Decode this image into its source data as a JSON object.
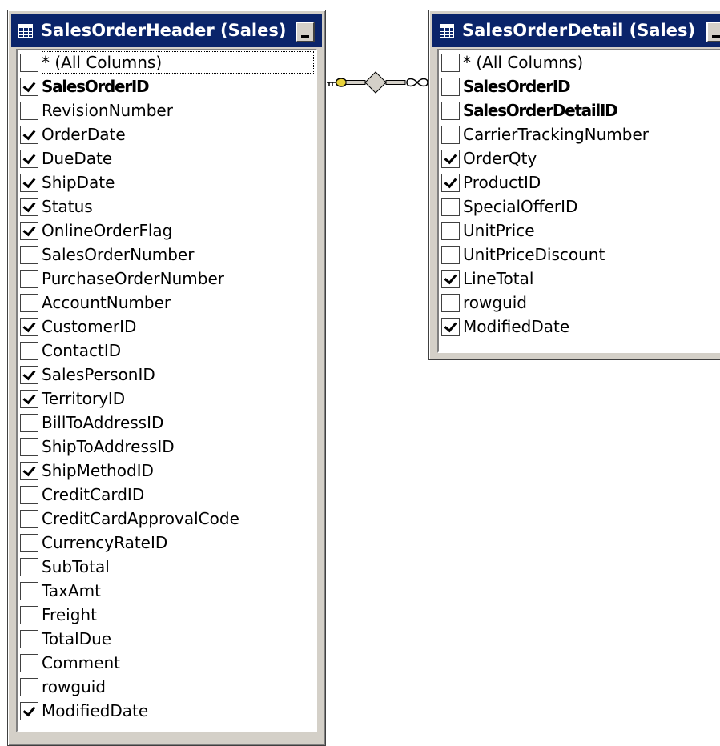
{
  "tables": [
    {
      "title": "SalesOrderHeader (Sales)",
      "columns": [
        {
          "label": "* (All Columns)",
          "checked": false,
          "key": false
        },
        {
          "label": "SalesOrderID",
          "checked": true,
          "key": true
        },
        {
          "label": "RevisionNumber",
          "checked": false,
          "key": false
        },
        {
          "label": "OrderDate",
          "checked": true,
          "key": false
        },
        {
          "label": "DueDate",
          "checked": true,
          "key": false
        },
        {
          "label": "ShipDate",
          "checked": true,
          "key": false
        },
        {
          "label": "Status",
          "checked": true,
          "key": false
        },
        {
          "label": "OnlineOrderFlag",
          "checked": true,
          "key": false
        },
        {
          "label": "SalesOrderNumber",
          "checked": false,
          "key": false
        },
        {
          "label": "PurchaseOrderNumber",
          "checked": false,
          "key": false
        },
        {
          "label": "AccountNumber",
          "checked": false,
          "key": false
        },
        {
          "label": "CustomerID",
          "checked": true,
          "key": false
        },
        {
          "label": "ContactID",
          "checked": false,
          "key": false
        },
        {
          "label": "SalesPersonID",
          "checked": true,
          "key": false
        },
        {
          "label": "TerritoryID",
          "checked": true,
          "key": false
        },
        {
          "label": "BillToAddressID",
          "checked": false,
          "key": false
        },
        {
          "label": "ShipToAddressID",
          "checked": false,
          "key": false
        },
        {
          "label": "ShipMethodID",
          "checked": true,
          "key": false
        },
        {
          "label": "CreditCardID",
          "checked": false,
          "key": false
        },
        {
          "label": "CreditCardApprovalCode",
          "checked": false,
          "key": false
        },
        {
          "label": "CurrencyRateID",
          "checked": false,
          "key": false
        },
        {
          "label": "SubTotal",
          "checked": false,
          "key": false
        },
        {
          "label": "TaxAmt",
          "checked": false,
          "key": false
        },
        {
          "label": "Freight",
          "checked": false,
          "key": false
        },
        {
          "label": "TotalDue",
          "checked": false,
          "key": false
        },
        {
          "label": "Comment",
          "checked": false,
          "key": false
        },
        {
          "label": "rowguid",
          "checked": false,
          "key": false
        },
        {
          "label": "ModifiedDate",
          "checked": true,
          "key": false
        }
      ]
    },
    {
      "title": "SalesOrderDetail (Sales)",
      "columns": [
        {
          "label": "* (All Columns)",
          "checked": false,
          "key": false
        },
        {
          "label": "SalesOrderID",
          "checked": false,
          "key": true
        },
        {
          "label": "SalesOrderDetailID",
          "checked": false,
          "key": true
        },
        {
          "label": "CarrierTrackingNumber",
          "checked": false,
          "key": false
        },
        {
          "label": "OrderQty",
          "checked": true,
          "key": false
        },
        {
          "label": "ProductID",
          "checked": true,
          "key": false
        },
        {
          "label": "SpecialOfferID",
          "checked": false,
          "key": false
        },
        {
          "label": "UnitPrice",
          "checked": false,
          "key": false
        },
        {
          "label": "UnitPriceDiscount",
          "checked": false,
          "key": false
        },
        {
          "label": "LineTotal",
          "checked": true,
          "key": false
        },
        {
          "label": "rowguid",
          "checked": false,
          "key": false
        },
        {
          "label": "ModifiedDate",
          "checked": true,
          "key": false
        }
      ]
    }
  ],
  "icons": {
    "table": "table-grid-icon",
    "minimize": "minimize-icon",
    "relationship_key": "key-icon",
    "relationship_join": "join-diamond-icon",
    "relationship_many": "infinity-icon"
  },
  "colors": {
    "titlebar": "#0a246a",
    "title_text": "#ffffff",
    "window_face": "#d4d0c8",
    "list_background": "#ffffff",
    "key_icon": "#e8d23a"
  }
}
